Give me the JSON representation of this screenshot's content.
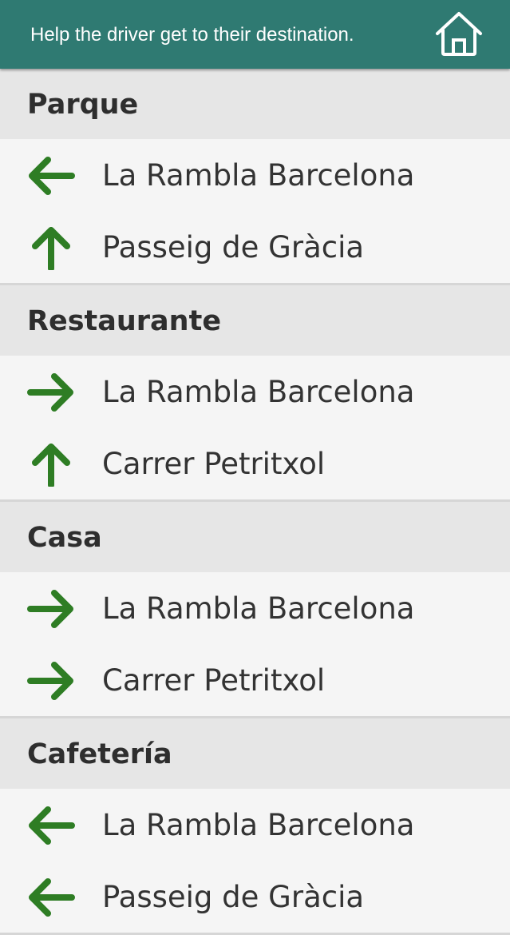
{
  "header": {
    "title": "Help the driver get to their destination.",
    "home_icon": "home-icon",
    "background": "#2f7a72"
  },
  "colors": {
    "arrow": "#2e7d24",
    "section_header_bg": "#e6e6e6",
    "row_bg": "#f5f5f5"
  },
  "sections": [
    {
      "title": "Parque",
      "routes": [
        {
          "direction": "left",
          "icon": "arrow-left-icon",
          "street": "La Rambla Barcelona"
        },
        {
          "direction": "up",
          "icon": "arrow-up-icon",
          "street": "Passeig de Gràcia"
        }
      ]
    },
    {
      "title": "Restaurante",
      "routes": [
        {
          "direction": "right",
          "icon": "arrow-right-icon",
          "street": "La Rambla Barcelona"
        },
        {
          "direction": "up",
          "icon": "arrow-up-icon",
          "street": "Carrer Petritxol"
        }
      ]
    },
    {
      "title": "Casa",
      "routes": [
        {
          "direction": "right",
          "icon": "arrow-right-icon",
          "street": "La Rambla Barcelona"
        },
        {
          "direction": "right",
          "icon": "arrow-right-icon",
          "street": "Carrer Petritxol"
        }
      ]
    },
    {
      "title": "Cafetería",
      "routes": [
        {
          "direction": "left",
          "icon": "arrow-left-icon",
          "street": "La Rambla Barcelona"
        },
        {
          "direction": "left",
          "icon": "arrow-left-icon",
          "street": "Passeig de Gràcia"
        }
      ]
    }
  ]
}
